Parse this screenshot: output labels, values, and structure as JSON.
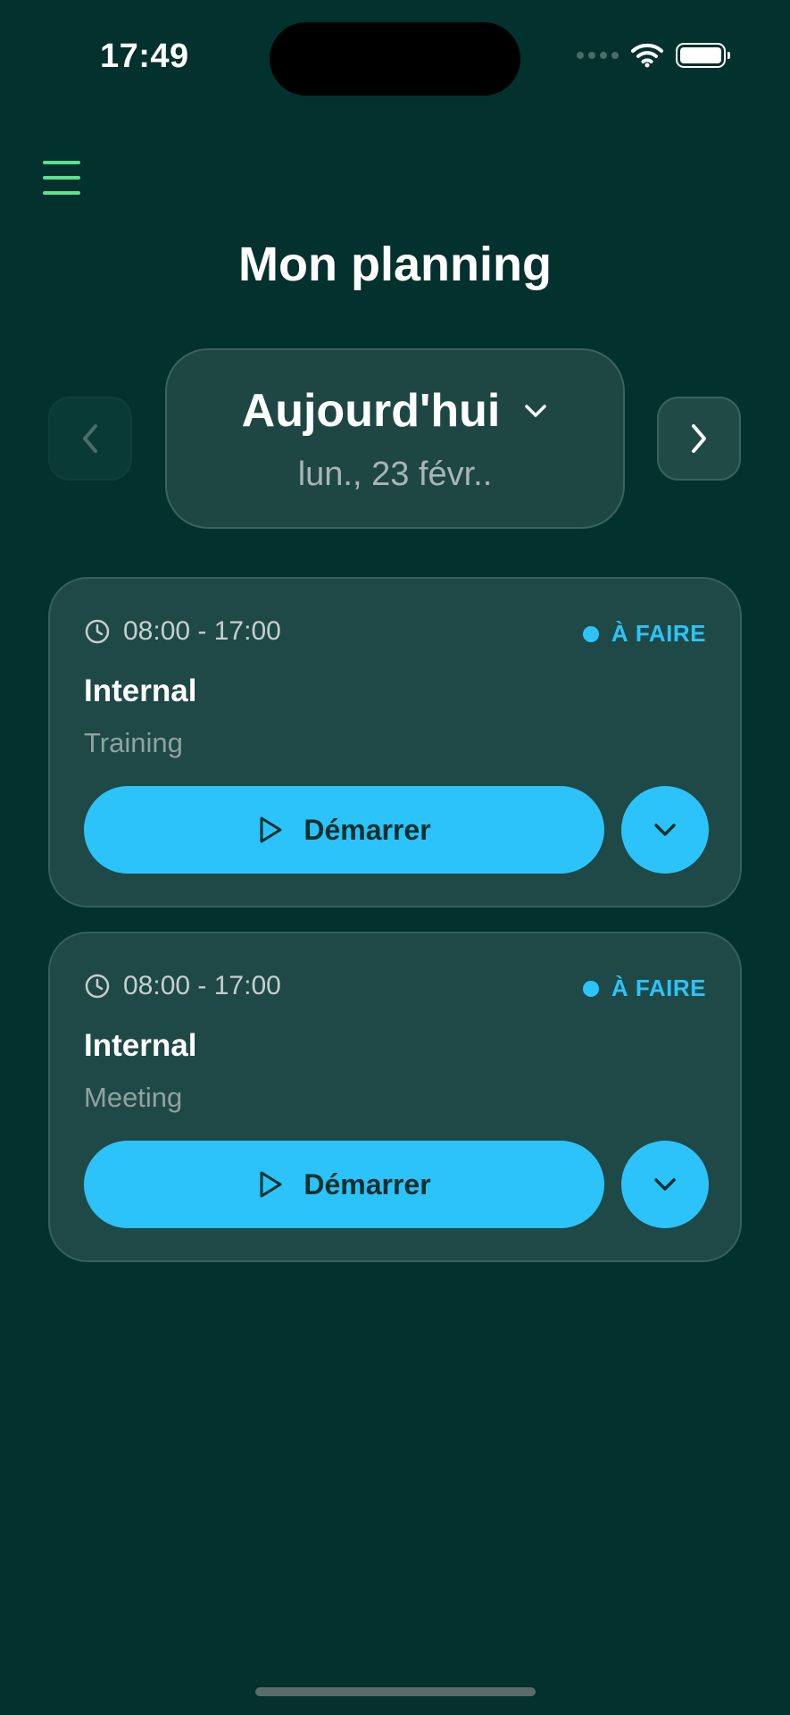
{
  "status_bar": {
    "time": "17:49"
  },
  "header": {
    "title": "Mon planning"
  },
  "date_selector": {
    "title": "Aujourd'hui",
    "subtitle": "lun., 23 févr.."
  },
  "tasks": [
    {
      "time": "08:00 - 17:00",
      "status": "À FAIRE",
      "title": "Internal",
      "subtitle": "Training",
      "action_label": "Démarrer"
    },
    {
      "time": "08:00 - 17:00",
      "status": "À FAIRE",
      "title": "Internal",
      "subtitle": "Meeting",
      "action_label": "Démarrer"
    }
  ],
  "colors": {
    "background": "#03312d",
    "card": "#1f4946",
    "accent": "#2cc3fb",
    "menu_icon": "#5fe08a"
  },
  "icons": {
    "menu": "hamburger-icon",
    "prev": "chevron-left-icon",
    "next": "chevron-right-icon",
    "date_dropdown": "chevron-down-icon",
    "time": "clock-icon",
    "start": "play-icon",
    "expand": "chevron-down-icon"
  }
}
